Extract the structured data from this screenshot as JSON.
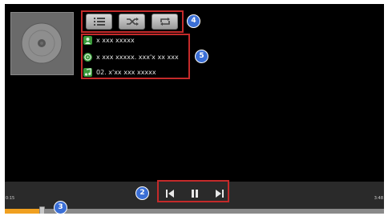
{
  "player": {
    "controls": {
      "playlist_icon": "list-icon",
      "shuffle_icon": "shuffle-icon",
      "repeat_icon": "repeat-icon"
    },
    "track_info": {
      "artist": "x xxx xxxxx",
      "album": "x xxx xxxxx. xxx'x xx xxx",
      "title": "02. x'xx xxx xxxxx"
    },
    "time": {
      "elapsed": "0:15",
      "total": "3:48"
    },
    "progress_fraction": 0.09
  },
  "callouts": {
    "transport": "2",
    "seek": "3",
    "controls": "4",
    "info": "5"
  },
  "colors": {
    "screen_bg": "#000000",
    "callout_border": "#c42a2a",
    "badge_bg": "#3b6fd6",
    "progress_fill": "#f0a020"
  }
}
